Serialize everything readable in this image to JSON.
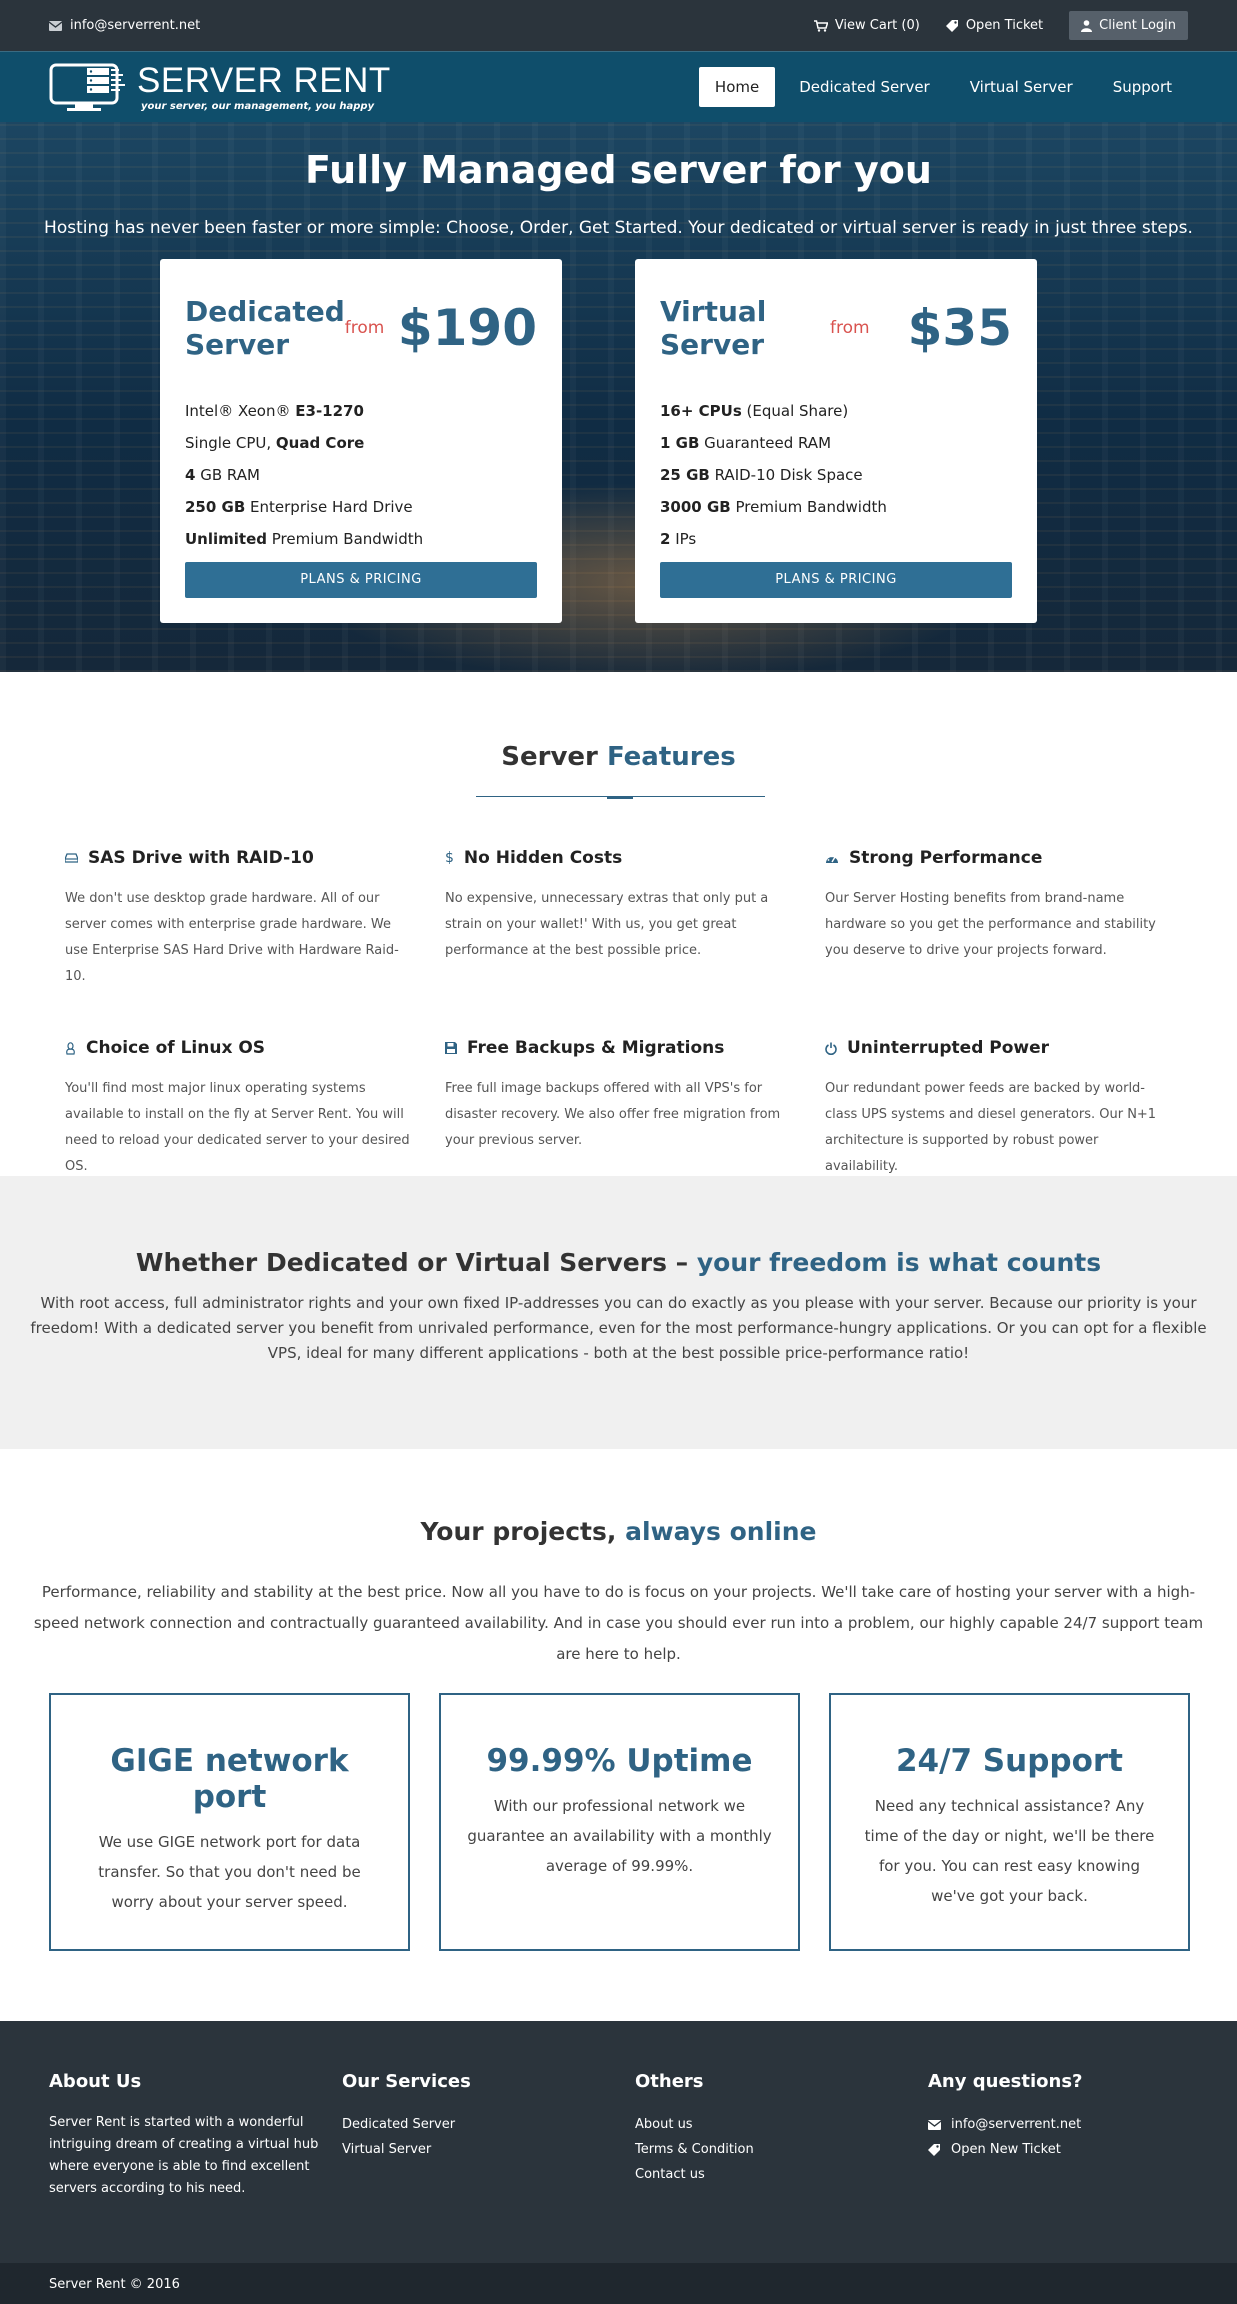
{
  "topbar": {
    "email": "info@serverrent.net",
    "view_cart": "View Cart (0)",
    "open_ticket": "Open Ticket",
    "client_login": "Client Login"
  },
  "brand": {
    "name": "SERVER RENT",
    "tagline": "your server, our management, you happy"
  },
  "nav": [
    {
      "label": "Home",
      "active": true
    },
    {
      "label": "Dedicated Server",
      "active": false
    },
    {
      "label": "Virtual Server",
      "active": false
    },
    {
      "label": "Support",
      "active": false
    }
  ],
  "hero": {
    "title": "Fully Managed server for you",
    "subtitle": "Hosting has never been faster or more simple: Choose, Order, Get Started. Your dedicated or virtual server is ready in just three steps."
  },
  "plans": [
    {
      "title_line1": "Dedicated",
      "title_line2": "Server",
      "from": "from",
      "price": "$190",
      "features": [
        {
          "pre": "Intel® Xeon® ",
          "bold": "E3-1270",
          "post": ""
        },
        {
          "pre": "Single CPU, ",
          "bold": "Quad Core",
          "post": ""
        },
        {
          "pre": "",
          "bold": "4",
          "post": " GB RAM"
        },
        {
          "pre": "",
          "bold": "250 GB",
          "post": " Enterprise Hard Drive"
        },
        {
          "pre": "",
          "bold": "Unlimited",
          "post": " Premium Bandwidth"
        }
      ],
      "button": "PLANS & PRICING"
    },
    {
      "title_line1": "Virtual",
      "title_line2": "Server",
      "from": "from",
      "price": "$35",
      "features": [
        {
          "pre": "",
          "bold": "16+ CPUs",
          "post": " (Equal Share)"
        },
        {
          "pre": "",
          "bold": "1 GB",
          "post": " Guaranteed RAM"
        },
        {
          "pre": "",
          "bold": "25 GB",
          "post": " RAID-10 Disk Space"
        },
        {
          "pre": "",
          "bold": "3000 GB",
          "post": " Premium Bandwidth"
        },
        {
          "pre": "",
          "bold": "2",
          "post": " IPs"
        }
      ],
      "button": "PLANS & PRICING"
    }
  ],
  "features": {
    "title_a": "Server ",
    "title_b": "Features",
    "items": [
      {
        "icon": "hdd-icon",
        "title": "SAS Drive with RAID-10",
        "text": "We don't use desktop grade hardware. All of our server comes with enterprise grade hardware. We use Enterprise SAS Hard Drive with Hardware Raid-10."
      },
      {
        "icon": "dollar-icon",
        "title": "No Hidden Costs",
        "text": "No expensive, unnecessary extras that only put a strain on your wallet!' With us, you get great performance at the best possible price."
      },
      {
        "icon": "dashboard-icon",
        "title": "Strong Performance",
        "text": "Our Server Hosting benefits from brand-name hardware so you get the performance and stability you deserve to drive your projects forward."
      },
      {
        "icon": "linux-icon",
        "title": "Choice of Linux OS",
        "text": "You'll find most major linux operating systems available to install on the fly at Server Rent. You will need to reload your dedicated server to your desired OS."
      },
      {
        "icon": "floppy-icon",
        "title": "Free Backups & Migrations",
        "text": "Free full image backups offered with all VPS's for disaster recovery. We also offer free migration from your previous server."
      },
      {
        "icon": "power-icon",
        "title": "Uninterrupted Power",
        "text": "Our redundant power feeds are backed by world-class UPS systems and diesel generators. Our N+1 architecture is supported by robust power availability."
      }
    ]
  },
  "freedom": {
    "title_a": "Whether Dedicated or Virtual Servers – ",
    "title_b": "your freedom is what counts",
    "text": "With root access, full administrator rights and your own fixed IP-addresses you can do exactly as you please with your server. Because our priority is your freedom! With a dedicated server you benefit from unrivaled performance, even for the most performance-hungry applications. Or you can opt for a flexible VPS, ideal for many different applications - both at the best possible price-performance ratio!"
  },
  "online": {
    "title_a": "Your projects, ",
    "title_b": "always online",
    "text": "Performance, reliability and stability at the best price. Now all you have to do is focus on your projects. We'll take care of hosting your server with a high-speed network connection and contractually guaranteed availability. And in case you should ever run into a problem, our highly capable 24/7 support team are here to help.",
    "boxes": [
      {
        "title": "GIGE network port",
        "text": "We use GIGE network port for data transfer. So that you don't need be worry about your server speed."
      },
      {
        "title": "99.99% Uptime",
        "text": "With our professional network we guarantee an availability with a monthly average of 99.99%."
      },
      {
        "title": "24/7 Support",
        "text": "Need any technical assistance? Any time of the day or night, we'll be there for you. You can rest easy knowing we've got your back."
      }
    ]
  },
  "footer": {
    "about_title": "About Us",
    "about_text": "Server Rent is started with a wonderful intriguing dream of creating a virtual hub where everyone is able to find excellent servers according to his need.",
    "services_title": "Our Services",
    "services": [
      "Dedicated Server",
      "Virtual Server"
    ],
    "others_title": "Others",
    "others": [
      "About us",
      "Terms & Condition",
      "Contact us"
    ],
    "questions_title": "Any questions?",
    "contact_email": "info@serverrent.net",
    "contact_ticket": "Open New Ticket",
    "copyright": "Server Rent © 2016"
  },
  "colors": {
    "topbar": "#2b343c",
    "navbar": "#0f4e6b",
    "accent": "#2f6384",
    "price_from": "#d9534f",
    "footer": "#2b343c"
  }
}
